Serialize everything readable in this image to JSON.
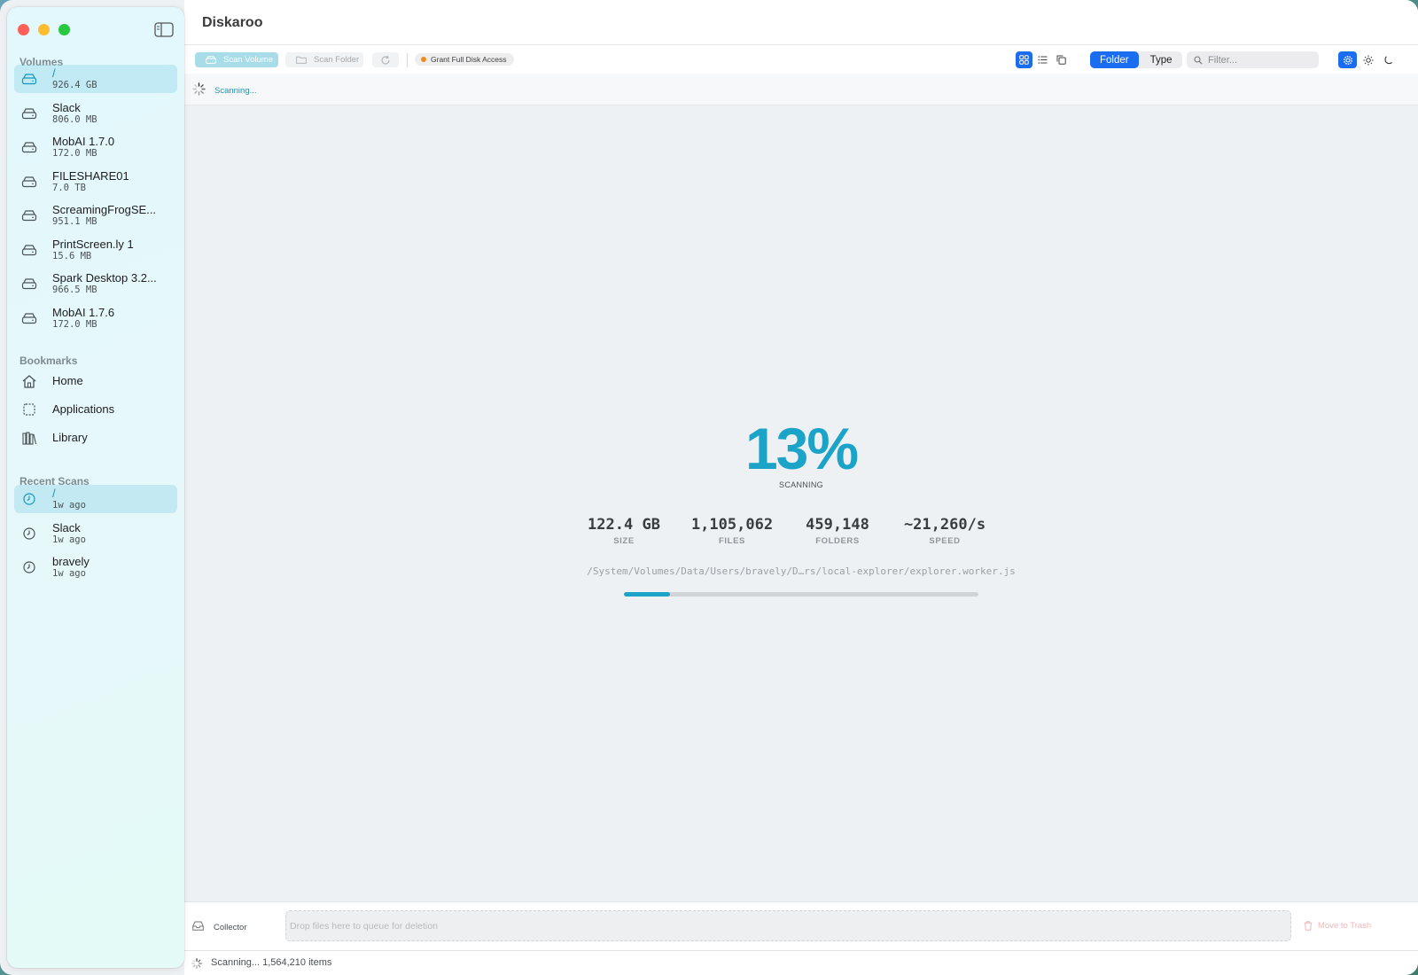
{
  "app": {
    "title": "Diskaroo"
  },
  "sidebar": {
    "volumes_title": "Volumes",
    "volumes": [
      {
        "name": "/",
        "size": "926.4 GB",
        "selected": true
      },
      {
        "name": "Slack",
        "size": "806.0 MB"
      },
      {
        "name": "MobAI 1.7.0",
        "size": "172.0 MB"
      },
      {
        "name": "FILESHARE01",
        "size": "7.0 TB"
      },
      {
        "name": "ScreamingFrogSE...",
        "size": "951.1 MB"
      },
      {
        "name": "PrintScreen.ly 1",
        "size": "15.6 MB"
      },
      {
        "name": "Spark Desktop 3.2...",
        "size": "966.5 MB"
      },
      {
        "name": "MobAI 1.7.6",
        "size": "172.0 MB"
      }
    ],
    "bookmarks_title": "Bookmarks",
    "bookmarks": [
      {
        "name": "Home",
        "icon": "house-icon"
      },
      {
        "name": "Applications",
        "icon": "applications-icon"
      },
      {
        "name": "Library",
        "icon": "library-icon"
      }
    ],
    "recent_title": "Recent Scans",
    "recent": [
      {
        "name": "/",
        "time": "1w ago",
        "selected": true
      },
      {
        "name": "Slack",
        "time": "1w ago"
      },
      {
        "name": "bravely",
        "time": "1w ago"
      }
    ]
  },
  "toolbar": {
    "scan_volume": "Scan Volume",
    "scan_folder": "Scan Folder",
    "grant_access": "Grant Full Disk Access",
    "group_folder": "Folder",
    "group_type": "Type",
    "filter_placeholder": "Filter..."
  },
  "status_strip": {
    "text": "Scanning..."
  },
  "scan": {
    "percent": "13%",
    "percent_value": 13,
    "label": "SCANNING",
    "stats": [
      {
        "value": "122.4 GB",
        "label": "SIZE"
      },
      {
        "value": "1,105,062",
        "label": "FILES"
      },
      {
        "value": "459,148",
        "label": "FOLDERS"
      },
      {
        "value": "~21,260/s",
        "label": "SPEED"
      }
    ],
    "current_path": "/System/Volumes/Data/Users/bravely/D…rs/local-explorer/explorer.worker.js"
  },
  "collector": {
    "label": "Collector",
    "drop_placeholder": "Drop files here to queue for deletion",
    "trash_label": "Move to Trash"
  },
  "bottom_status": {
    "text": "Scanning... 1,564,210 items"
  },
  "colors": {
    "accent": "#1ca3c8",
    "selection": "#1a6cf0",
    "warning_dot": "#f08a1c"
  }
}
